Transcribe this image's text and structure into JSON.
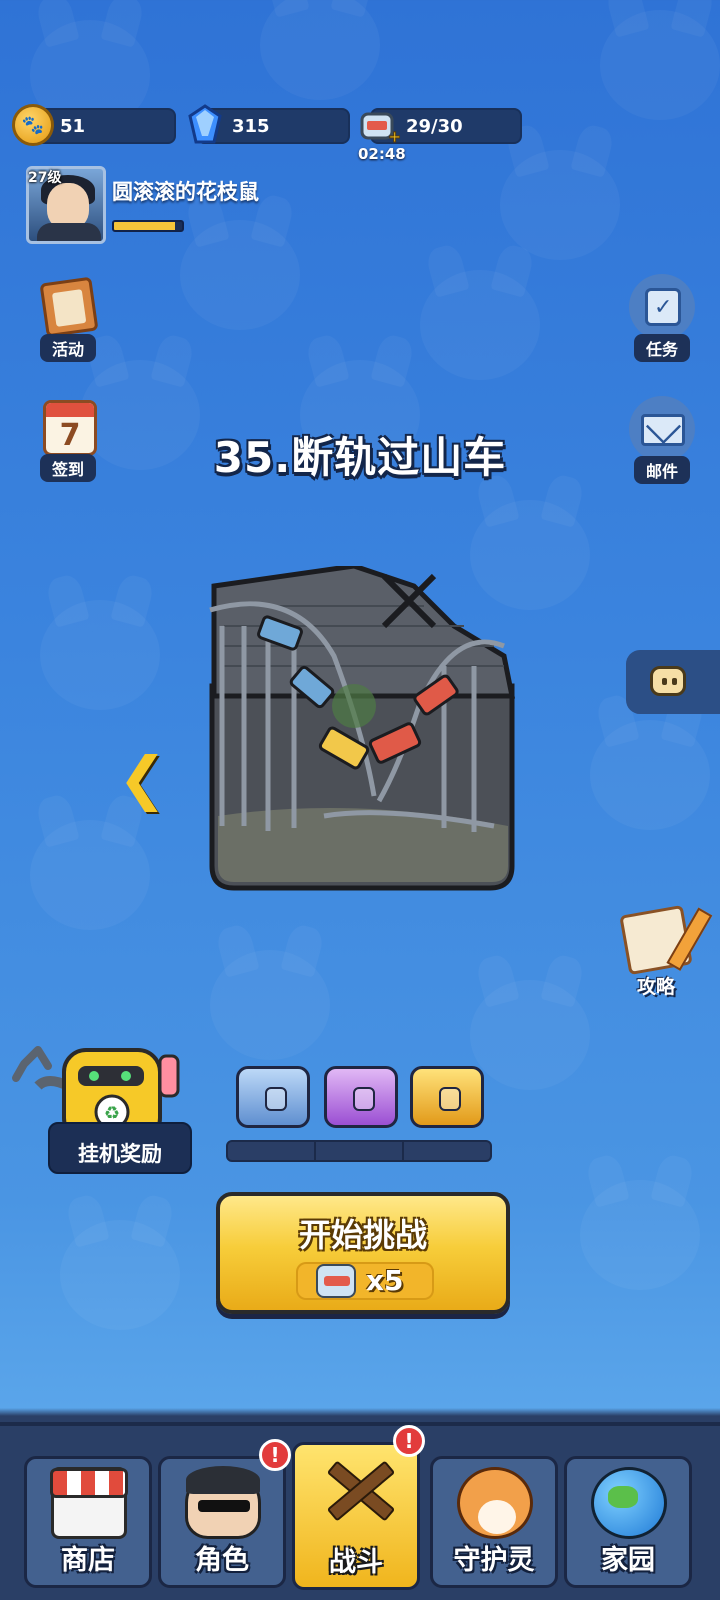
{
  "resources": {
    "coin": {
      "value": "51",
      "icon": "paw-coin-icon"
    },
    "gem": {
      "value": "315",
      "icon": "blue-gem-icon"
    },
    "stamina": {
      "value": "29/30",
      "icon": "canned-food-icon",
      "timer": "02:48"
    }
  },
  "profile": {
    "level": "27级",
    "name": "圆滚滚的花枝鼠",
    "xp_fraction": 0.9
  },
  "left_menu": {
    "activity": "活动",
    "checkin": "签到",
    "checkin_day": "7"
  },
  "right_menu": {
    "tasks": "任务",
    "mail": "邮件"
  },
  "stage": {
    "title": "35.断轨过山车",
    "guide": "攻略"
  },
  "idle_reward": {
    "label": "挂机奖励",
    "progress_segments": 3
  },
  "start": {
    "label": "开始挑战",
    "cost": "x5"
  },
  "nav": {
    "shop": "商店",
    "character": "角色",
    "battle": "战斗",
    "guardian": "守护灵",
    "home": "家园",
    "alert_mark": "!"
  },
  "colors": {
    "background": "#3b84de",
    "accent_gold": "#f7cd3a",
    "panel": "#1f3a69",
    "alert": "#e23c3c"
  }
}
